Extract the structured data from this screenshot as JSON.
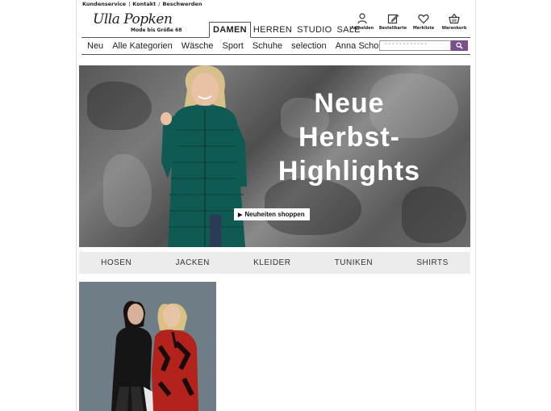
{
  "service": {
    "links": [
      "Kundenservice",
      "Kontakt",
      "Beschwerden"
    ]
  },
  "brand": {
    "logo_text": "Ulla Popken",
    "tagline": "Mode bis Größe 68"
  },
  "gender_nav": [
    {
      "label": "DAMEN",
      "active": true
    },
    {
      "label": "HERREN",
      "active": false
    },
    {
      "label": "STUDIO",
      "active": false
    },
    {
      "label": "SALE",
      "active": false
    }
  ],
  "header_icons": [
    {
      "icon": "user-icon",
      "label": "Anmelden"
    },
    {
      "icon": "edit-icon",
      "label": "Bestellkarte"
    },
    {
      "icon": "heart-icon",
      "label": "Merkliste"
    },
    {
      "icon": "basket-icon",
      "label": "Warenkorb"
    }
  ],
  "category_nav": [
    "Neu",
    "Alle Kategorien",
    "Wäsche",
    "Sport",
    "Schuhe",
    "selection",
    "Anna Scholz"
  ],
  "search": {
    "placeholder": "°°°°°°°°°°°°",
    "icon": "search-icon",
    "button_color": "#7a4f8c"
  },
  "hero": {
    "headline": [
      "Neue",
      "Herbst-",
      "Highlights"
    ],
    "cta_label": "Neuheiten shoppen",
    "jacket_color": "#0f5a52"
  },
  "product_links": [
    "HOSEN",
    "JACKEN",
    "KLEIDER",
    "TUNIKEN",
    "SHIRTS"
  ]
}
